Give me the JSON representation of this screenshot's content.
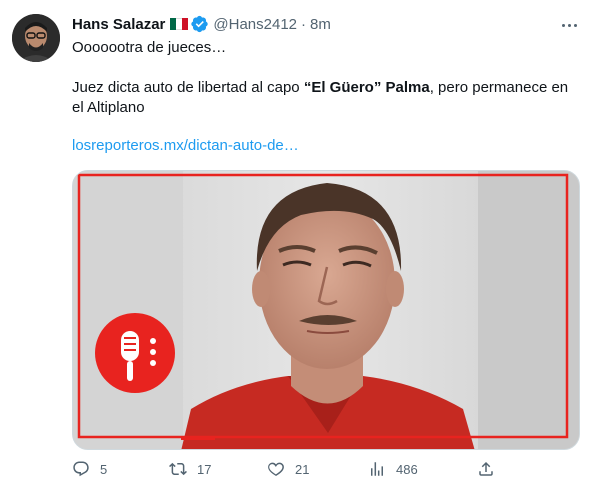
{
  "author": {
    "name": "Hans Salazar",
    "handle": "@Hans2412",
    "separator": "·",
    "time": "8m",
    "flag_colors": [
      "#006847",
      "#ffffff",
      "#ce1126"
    ],
    "verified_color": "#1d9bf0"
  },
  "tweet": {
    "line1": "Ooooootra de jueces…",
    "line2_prefix": "Juez dicta auto de libertad al capo ",
    "line2_quote": "“El Güero”",
    "line2_space": " ",
    "line2_bold": "Palma",
    "line2_suffix": ", pero permanece en",
    "line3": "el Altiplano",
    "link": "losreporteros.mx/dictan-auto-de…"
  },
  "media": {
    "description_icon": "microphone-logo-icon",
    "frame_color": "#e8231f",
    "shirt_color": "#c62a22"
  },
  "actions": {
    "replies": "5",
    "retweets": "17",
    "likes": "21",
    "views": "486"
  },
  "icons": {
    "reply": "reply-icon",
    "retweet": "retweet-icon",
    "like": "heart-icon",
    "views": "views-icon",
    "share": "share-icon",
    "more": "more-icon"
  }
}
